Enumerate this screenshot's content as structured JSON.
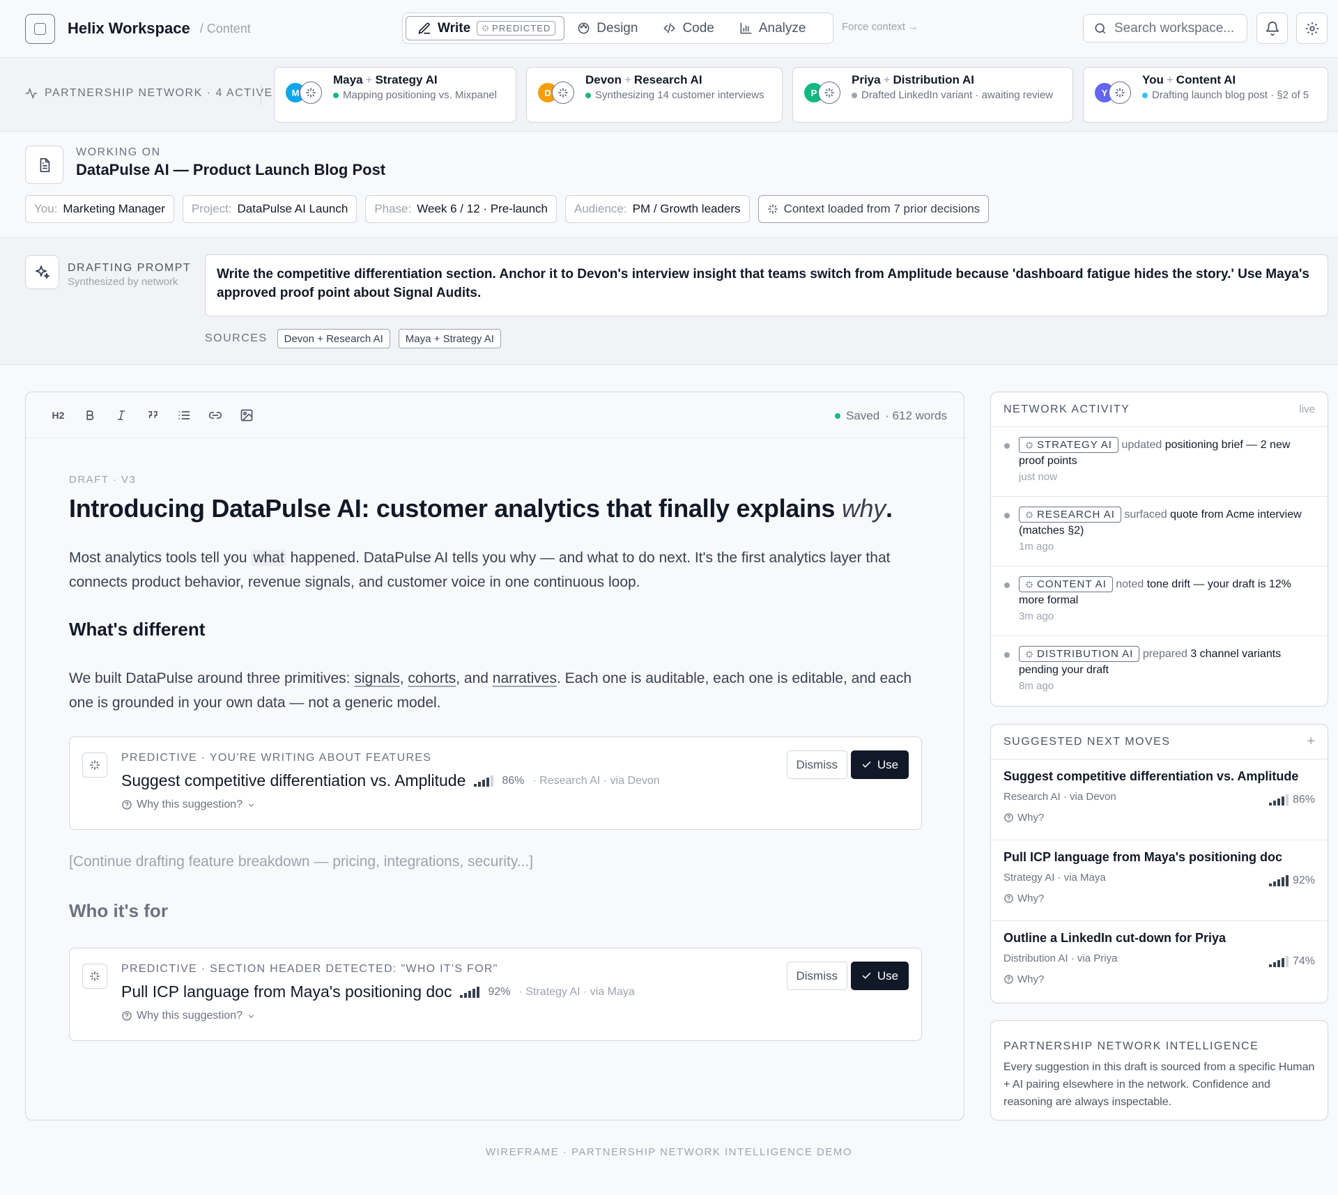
{
  "header": {
    "app_title": "Helix Workspace",
    "breadcrumb": "/ Content",
    "modes": [
      {
        "label": "Write",
        "badge": "PREDICTED",
        "active": true
      },
      {
        "label": "Design"
      },
      {
        "label": "Code"
      },
      {
        "label": "Analyze"
      }
    ],
    "force_context": "Force context →",
    "search_placeholder": "Search workspace..."
  },
  "network": {
    "label": "PARTNERSHIP NETWORK · 4 ACTIVE",
    "partners": [
      {
        "initial": "M",
        "human": "Maya",
        "ai": "Strategy AI",
        "status": "Mapping positioning vs. Mixpanel",
        "avatar_color": "#0ea5e9",
        "dot_color": "#10b981"
      },
      {
        "initial": "D",
        "human": "Devon",
        "ai": "Research AI",
        "status": "Synthesizing 14 customer interviews",
        "avatar_color": "#f59e0b",
        "dot_color": "#10b981"
      },
      {
        "initial": "P",
        "human": "Priya",
        "ai": "Distribution AI",
        "status": "Drafted LinkedIn variant · awaiting review",
        "avatar_color": "#10b981",
        "dot_color": "#9ca3af"
      },
      {
        "initial": "Y",
        "human": "You",
        "ai": "Content AI",
        "status": "Drafting launch blog post · §2 of 5",
        "avatar_color": "#6366f1",
        "dot_color": "#38bdf8"
      }
    ]
  },
  "working_on": {
    "label": "WORKING ON",
    "title": "DataPulse AI — Product Launch Blog Post",
    "chips": [
      {
        "key": "You:",
        "value": "Marketing Manager"
      },
      {
        "key": "Project:",
        "value": "DataPulse AI Launch"
      },
      {
        "key": "Phase:",
        "value": "Week 6 / 12 · Pre-launch"
      },
      {
        "key": "Audience:",
        "value": "PM / Growth leaders"
      }
    ],
    "context_chip": "Context loaded from 7 prior decisions"
  },
  "prompt": {
    "label": "DRAFTING PROMPT",
    "sub": "Synthesized by network",
    "text": "Write the competitive differentiation section. Anchor it to Devon's interview insight that teams switch from Amplitude because 'dashboard fatigue hides the story.' Use Maya's approved proof point about Signal Audits.",
    "sources_label": "SOURCES",
    "sources": [
      "Devon + Research AI",
      "Maya + Strategy AI"
    ]
  },
  "editor": {
    "toolbar": [
      "H2",
      "B",
      "I",
      "quote",
      "list",
      "link",
      "image"
    ],
    "saved": "Saved",
    "words": "· 612 words",
    "draft_label": "DRAFT · V3",
    "title_main": "Introducing DataPulse AI: customer analytics that finally explains ",
    "title_em": "why",
    "title_end": ".",
    "p1_a": "Most analytics tools tell you ",
    "p1_hl": "what",
    "p1_b": " happened. DataPulse AI tells you why — and what to do next. It's the first analytics layer that connects product behavior, revenue signals, and customer voice in one continuous loop.",
    "h_diff": "What's different",
    "p2_a": "We built DataPulse around three primitives: ",
    "p2_u1": "signals",
    "p2_c1": ", ",
    "p2_u2": "cohorts",
    "p2_c2": ", and ",
    "p2_u3": "narratives",
    "p2_b": ". Each one is auditable, each one is editable, and each one is grounded in your own data — not a generic model.",
    "suggestions": [
      {
        "label": "PREDICTIVE · YOU'RE WRITING ABOUT FEATURES",
        "title": "Suggest competitive differentiation vs. Amplitude",
        "confidence": 86,
        "pct": "86%",
        "source": "· Research AI · via Devon",
        "why": "Why this suggestion?",
        "dismiss": "Dismiss",
        "use": "Use"
      },
      {
        "label": "PREDICTIVE · SECTION HEADER DETECTED: \"WHO IT'S FOR\"",
        "title": "Pull ICP language from Maya's positioning doc",
        "confidence": 92,
        "pct": "92%",
        "source": "· Strategy AI · via Maya",
        "why": "Why this suggestion?",
        "dismiss": "Dismiss",
        "use": "Use"
      }
    ],
    "placeholder": "[Continue drafting feature breakdown — pricing, integrations, security...]",
    "h_who": "Who it's for"
  },
  "activity": {
    "title": "NETWORK ACTIVITY",
    "live": "live",
    "items": [
      {
        "agent": "STRATEGY AI",
        "verb": "updated",
        "text": "positioning brief — 2 new proof points",
        "time": "just now"
      },
      {
        "agent": "RESEARCH AI",
        "verb": "surfaced",
        "text": "quote from Acme interview (matches §2)",
        "time": "1m ago"
      },
      {
        "agent": "CONTENT AI",
        "verb": "noted",
        "text": "tone drift — your draft is 12% more formal",
        "time": "3m ago"
      },
      {
        "agent": "DISTRIBUTION AI",
        "verb": "prepared",
        "text": "3 channel variants pending your draft",
        "time": "8m ago"
      }
    ]
  },
  "moves": {
    "title": "SUGGESTED NEXT MOVES",
    "add": "+",
    "items": [
      {
        "title": "Suggest competitive differentiation vs. Amplitude",
        "source": "Research AI · via Devon",
        "confidence": 86,
        "pct": "86%",
        "why": "Why?"
      },
      {
        "title": "Pull ICP language from Maya's positioning doc",
        "source": "Strategy AI · via Maya",
        "confidence": 92,
        "pct": "92%",
        "why": "Why?"
      },
      {
        "title": "Outline a LinkedIn cut-down for Priya",
        "source": "Distribution AI · via Priya",
        "confidence": 74,
        "pct": "74%",
        "why": "Why?"
      }
    ]
  },
  "intel": {
    "title": "PARTNERSHIP NETWORK INTELLIGENCE",
    "text": "Every suggestion in this draft is sourced from a specific Human + AI pairing elsewhere in the network. Confidence and reasoning are always inspectable."
  },
  "footer": "WIREFRAME · PARTNERSHIP NETWORK INTELLIGENCE DEMO"
}
